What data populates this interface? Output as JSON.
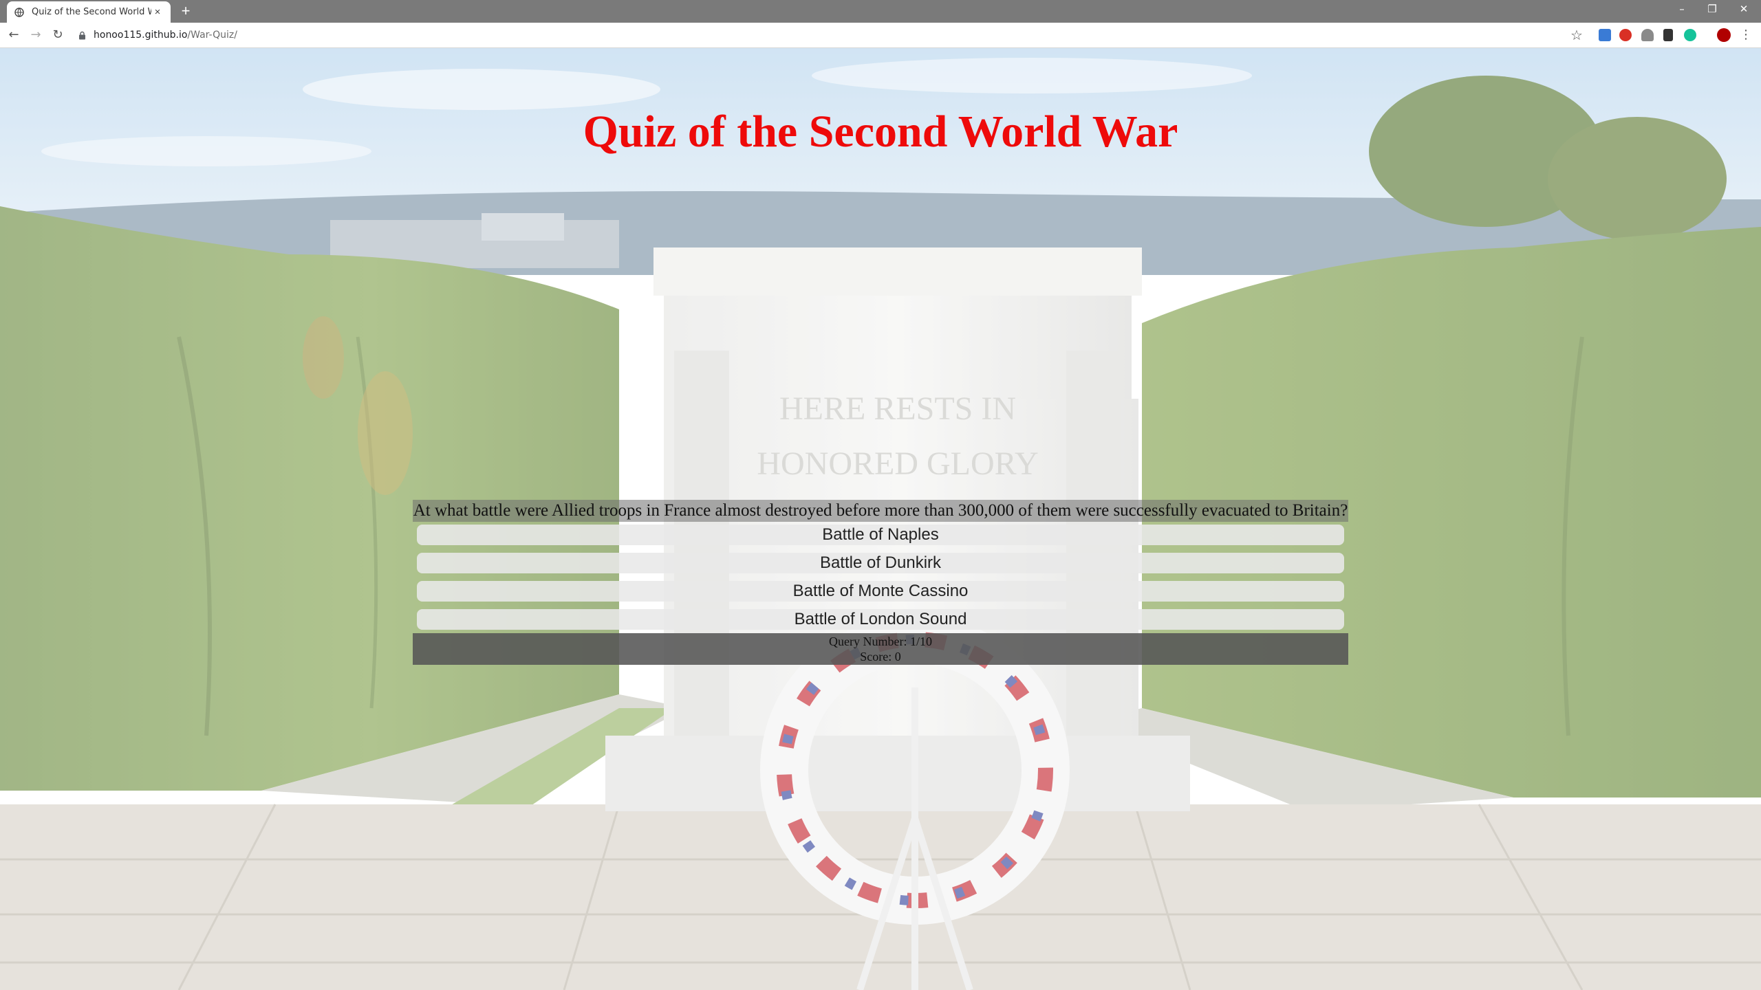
{
  "browser": {
    "tab_title": "Quiz of the Second World War",
    "tab_close": "×",
    "new_tab": "+",
    "url_host": "honoo115.github.io",
    "url_path": "/War-Quiz/",
    "back": "←",
    "forward": "→",
    "reload": "↻",
    "bookmark": "☆",
    "menu": "⋮",
    "minimize": "–",
    "restore": "❐",
    "close": "✕"
  },
  "page": {
    "title": "Quiz of the Second World War"
  },
  "quiz": {
    "question": "At what battle were Allied troops in France almost destroyed before more than 300,000 of them were successfully evacuated to Britain?",
    "answers": [
      "Battle of Naples",
      "Battle of Dunkirk",
      "Battle of Monte Cassino",
      "Battle of London Sound"
    ],
    "query_number_label": "Query Number: 1/10",
    "score_label": "Score: 0"
  },
  "colors": {
    "title": "#ee0a0a",
    "tab_bar": "#7a7a7a"
  },
  "background_image": {
    "inscription_line1": "HERE RESTS IN",
    "inscription_line2": "HONORED GLORY"
  }
}
